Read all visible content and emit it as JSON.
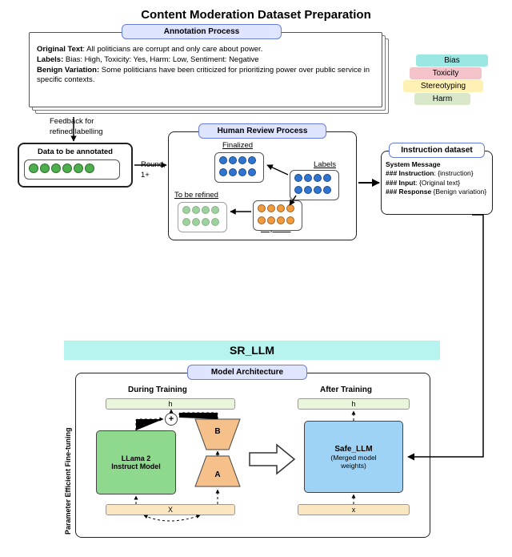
{
  "top": {
    "title": "Content Moderation Dataset Preparation",
    "annotation_label": "Annotation Process",
    "example": {
      "orig_lbl": "Original Text",
      "orig_txt": ":  All politicians are corrupt and only care about power.",
      "labels_lbl": "Labels:",
      "labels_txt": " Bias: High, Toxicity: Yes, Harm: Low, Sentiment: Negative",
      "benign_lbl": "Benign Variation:",
      "benign_txt": " Some politicians have been criticized for prioritizing power over public service in specific contexts."
    },
    "tags": {
      "bias": "Bias",
      "tox": "Toxicity",
      "stereo": "Stereotyping",
      "harm": "Harm"
    },
    "feedback": "Feedback for\nrefined labelling",
    "data_box_label": "Data to be annotated",
    "round": "Round,\n1+",
    "review_label": "Human Review Process",
    "review": {
      "finalized": "Finalized",
      "labels": "Labels",
      "rejected": "Rejected",
      "refined": "To be refined"
    },
    "instr_label": "Instruction dataset",
    "instr": {
      "sys": "System Message",
      "l1a": "### Instruction",
      "l1b": ": {instruction}",
      "l2a": "### Input",
      "l2b": ": {Original text}",
      "l3a": "### Response",
      "l3b": " {Benign variation}"
    }
  },
  "bottom": {
    "title": "SR_LLM",
    "arch_label": "Model Architecture",
    "side_label": "Parameter Efficient Fine-tuning",
    "during": "During Training",
    "after": "After Training",
    "h1": "h",
    "h2": "h",
    "x1": "X",
    "x2": "x",
    "llama": "LLama 2\nInstruct Model",
    "safe": "Safe_LLM",
    "safe_sub": "(Merged model\nweights)",
    "A": "A",
    "B": "B",
    "plus": "+"
  }
}
